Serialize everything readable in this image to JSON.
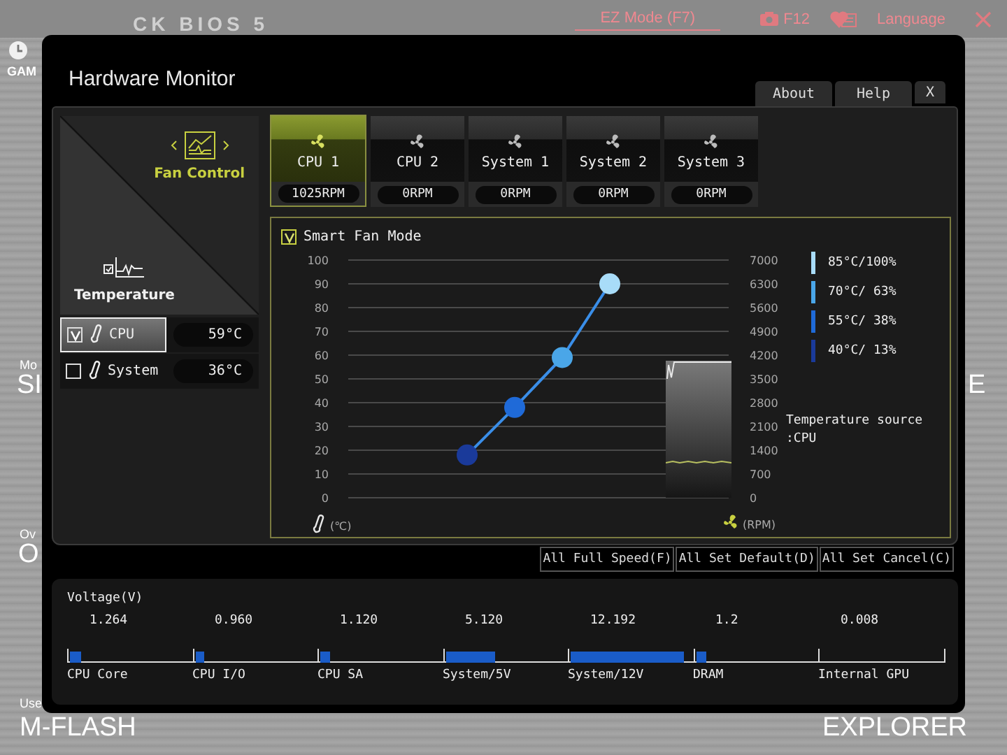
{
  "background": {
    "title": "CK BIOS 5",
    "ez_mode": "EZ Mode (F7)",
    "screenshot_key": "F12",
    "language": "Language",
    "left_fragments": [
      {
        "kind": "small",
        "text": "GAM"
      },
      {
        "kind": "small",
        "text": "Mo"
      },
      {
        "kind": "large",
        "text": "SI"
      },
      {
        "kind": "small",
        "text": "Ov"
      },
      {
        "kind": "large",
        "text": "O"
      },
      {
        "kind": "small",
        "text": "Use"
      },
      {
        "kind": "large",
        "text": "M-FLASH"
      }
    ],
    "right_fragments": [
      {
        "kind": "large",
        "text": "E"
      },
      {
        "kind": "large",
        "text": "EXPLORER"
      }
    ]
  },
  "dialog": {
    "title": "Hardware Monitor",
    "buttons": [
      "About",
      "Help",
      "X"
    ]
  },
  "modes": [
    {
      "label": "Fan Control",
      "selected": true
    },
    {
      "label": "Temperature",
      "selected": false
    }
  ],
  "sensors": [
    {
      "name": "CPU",
      "checked": true,
      "selected": true,
      "value": "59°C"
    },
    {
      "name": "System",
      "checked": false,
      "selected": false,
      "value": "36°C"
    }
  ],
  "fans": [
    {
      "label": "CPU 1",
      "selected": true,
      "speed": "1025RPM"
    },
    {
      "label": "CPU 2",
      "selected": false,
      "speed": "0RPM"
    },
    {
      "label": "System 1",
      "selected": false,
      "speed": "0RPM"
    },
    {
      "label": "System 2",
      "selected": false,
      "speed": "0RPM"
    },
    {
      "label": "System 3",
      "selected": false,
      "speed": "0RPM"
    }
  ],
  "smart_fan": {
    "label": "Smart Fan Mode",
    "checked": true
  },
  "chart": {
    "chart_data": {
      "type": "line",
      "categories": [
        null,
        null,
        null,
        null,
        null,
        null,
        null,
        null
      ],
      "ylim": [
        0,
        100
      ],
      "yticks": [
        0,
        10,
        20,
        30,
        40,
        50,
        60,
        70,
        80,
        90,
        100
      ],
      "grid": true,
      "series": [
        {
          "color": "#3a8ee8",
          "marker": "o",
          "values": [
            null,
            null,
            18,
            38,
            59,
            90,
            null,
            null
          ]
        }
      ]
    },
    "x_unit": "(℃)",
    "rpm_unit": "(RPM)",
    "rpm_ticks": [
      "7000",
      "6300",
      "5600",
      "4900",
      "4200",
      "3500",
      "2800",
      "2100",
      "1400",
      "700",
      "0"
    ]
  },
  "legend": [
    {
      "text": "85°C/100%",
      "color": "#a8dcf8"
    },
    {
      "text": "70°C/ 63%",
      "color": "#4aa6e8"
    },
    {
      "text": "55°C/ 38%",
      "color": "#1f6ad8"
    },
    {
      "text": "40°C/ 13%",
      "color": "#1a3a9a"
    }
  ],
  "temperature_source": [
    "Temperature source",
    ":CPU"
  ],
  "actions": [
    "All Full Speed(F)",
    "All Set Default(D)",
    "All Set Cancel(C)"
  ],
  "voltage": {
    "title": "Voltage(V)",
    "rails": [
      {
        "name": "CPU Core",
        "reading": "1.264",
        "level": 0.09
      },
      {
        "name": "CPU I/O",
        "reading": "0.960",
        "level": 0.07
      },
      {
        "name": "CPU SA",
        "reading": "1.120",
        "level": 0.08
      },
      {
        "name": "System/5V",
        "reading": "5.120",
        "level": 0.4
      },
      {
        "name": "System/12V",
        "reading": "12.192",
        "level": 0.92
      },
      {
        "name": "DRAM",
        "reading": "1.2",
        "level": 0.09
      },
      {
        "name": "Internal GPU",
        "reading": "0.008",
        "level": 0
      }
    ]
  }
}
